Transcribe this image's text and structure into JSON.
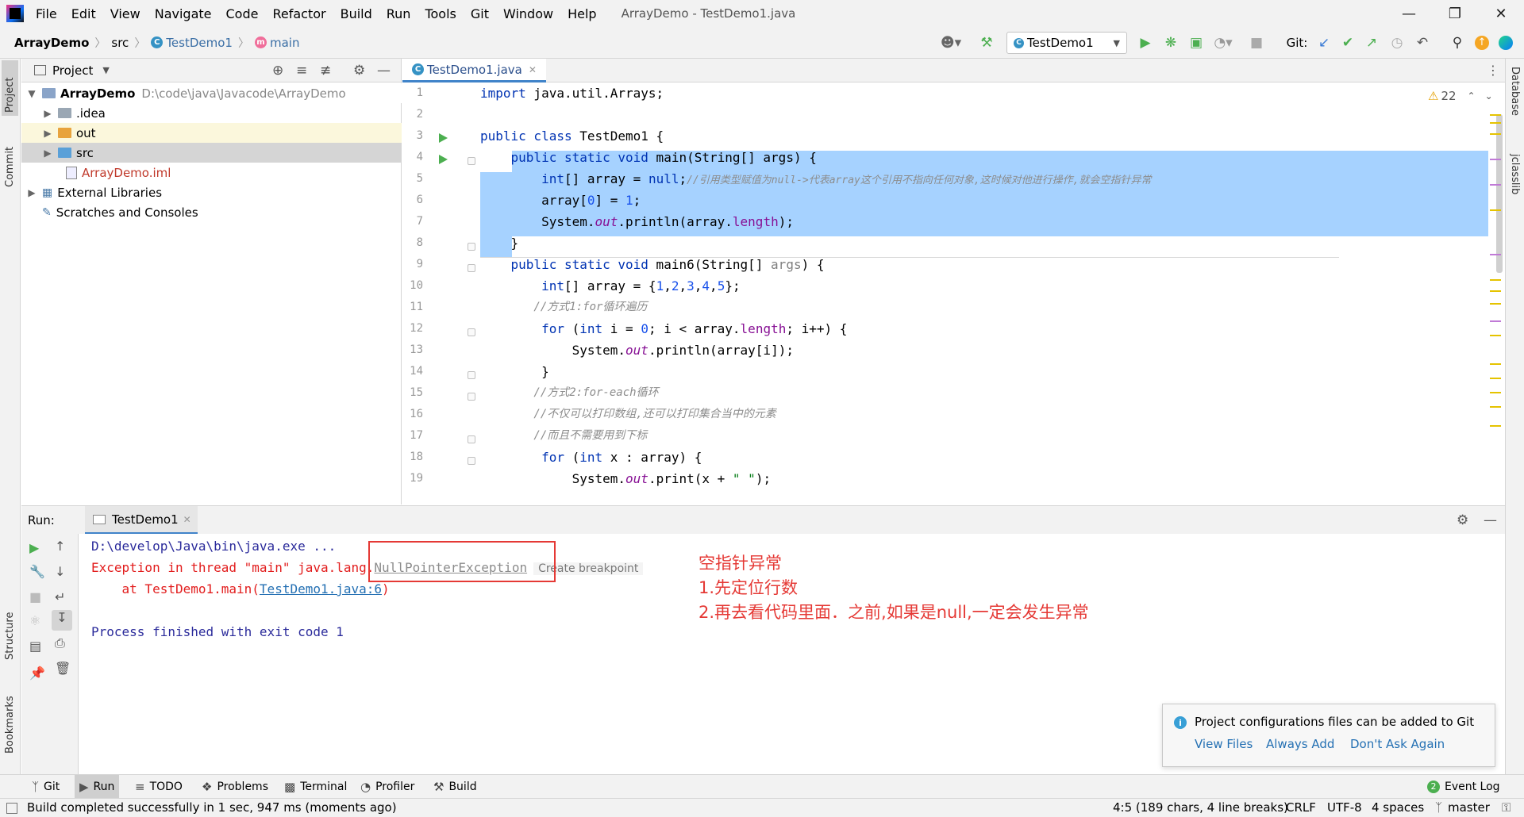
{
  "menu": {
    "items": [
      "File",
      "Edit",
      "View",
      "Navigate",
      "Code",
      "Refactor",
      "Build",
      "Run",
      "Tools",
      "Git",
      "Window",
      "Help"
    ],
    "window_title": "ArrayDemo - TestDemo1.java"
  },
  "breadcrumb": {
    "project": "ArrayDemo",
    "folder": "src",
    "class": "TestDemo1",
    "method": "main"
  },
  "toolbar": {
    "run_config": "TestDemo1",
    "git_label": "Git:"
  },
  "project_panel": {
    "title": "Project",
    "root_name": "ArrayDemo",
    "root_path": "D:\\code\\java\\Javacode\\ArrayDemo",
    "items": [
      ".idea",
      "out",
      "src",
      "ArrayDemo.iml"
    ],
    "external": "External Libraries",
    "scratches": "Scratches and Consoles"
  },
  "editor": {
    "tab": "TestDemo1.java",
    "warnings": "22",
    "line_numbers": [
      "1",
      "2",
      "3",
      "4",
      "5",
      "6",
      "7",
      "8",
      "9",
      "10",
      "11",
      "12",
      "13",
      "14",
      "15",
      "16",
      "17",
      "18",
      "19"
    ],
    "lines": {
      "l1a": "import",
      "l1b": " java.util.Arrays;",
      "l3a": "public class",
      "l3b": " TestDemo1 {",
      "l4a": "    public static void",
      "l4b": " main(String[] args) {",
      "l5a": "        int",
      "l5b": "[] array = ",
      "l5c": "null",
      "l5d": ";",
      "l5e": "//引用类型赋值为null->代表array这个引用不指向任何对象,这时候对他进行操作,就会空指针异常",
      "l6a": "        array[",
      "l6b": "0",
      "l6c": "] = ",
      "l6d": "1",
      "l6e": ";",
      "l7a": "        System.",
      "l7b": "out",
      "l7c": ".println(array.",
      "l7d": "length",
      "l7e": ");",
      "l8": "    }",
      "l9a": "    public static void",
      "l9b": " main6(String[] ",
      "l9c": "args",
      "l9d": ") {",
      "l10a": "        int",
      "l10b": "[] array = {",
      "l10c": "1",
      "l10d": ",",
      "l10e": "2",
      "l10f": ",",
      "l10g": "3",
      "l10h": ",",
      "l10i": "4",
      "l10j": ",",
      "l10k": "5",
      "l10l": "};",
      "l11": "        //方式1:for循环遍历",
      "l12a": "        for",
      "l12b": " (",
      "l12c": "int",
      "l12d": " i = ",
      "l12e": "0",
      "l12f": "; i < array.",
      "l12g": "length",
      "l12h": "; i++) {",
      "l13a": "            System.",
      "l13b": "out",
      "l13c": ".println(array[i]);",
      "l14": "        }",
      "l15": "        //方式2:for-each循环",
      "l16": "        //不仅可以打印数组,还可以打印集合当中的元素",
      "l17": "        //而且不需要用到下标",
      "l18a": "        for",
      "l18b": " (",
      "l18c": "int",
      "l18d": " x : array) {",
      "l19a": "            System.",
      "l19b": "out",
      "l19c": ".print(x + ",
      "l19d": "\" \"",
      "l19e": ");"
    }
  },
  "run_panel": {
    "label": "Run:",
    "tab": "TestDemo1",
    "console": {
      "cmd": "D:\\develop\\Java\\bin\\java.exe ...",
      "exc_prefix": "Exception in thread \"main\" java.lang.",
      "exc_class": "NullPointerException",
      "create_bp": "Create breakpoint",
      "at_prefix": "    at TestDemo1.main(",
      "at_link": "TestDemo1.java:6",
      "at_suffix": ")",
      "finished": "Process finished with exit code 1"
    },
    "annotation": {
      "line1": "空指针异常",
      "line2": "1.先定位行数",
      "line3": "2.再去看代码里面．之前,如果是null,一定会发生异常"
    }
  },
  "notification": {
    "message": "Project configurations files can be added to Git",
    "actions": [
      "View Files",
      "Always Add",
      "Don't Ask Again"
    ]
  },
  "tool_windows": [
    "Git",
    "Run",
    "TODO",
    "Problems",
    "Terminal",
    "Profiler",
    "Build",
    "Event Log"
  ],
  "side_tabs": {
    "project": "Project",
    "commit": "Commit",
    "structure": "Structure",
    "bookmarks": "Bookmarks",
    "database": "Database",
    "jclasslib": "jclasslib"
  },
  "status_bar": {
    "message": "Build completed successfully in 1 sec, 947 ms (moments ago)",
    "position": "4:5 (189 chars, 4 line breaks)",
    "line_sep": "CRLF",
    "encoding": "UTF-8",
    "indent": "4 spaces",
    "branch": "master"
  },
  "colors": {
    "keyword": "#0033b3",
    "number": "#1750eb",
    "comment": "#8c8c8c",
    "field": "#871094",
    "error": "#e21d1d",
    "selection": "#a6d2ff",
    "annotation": "#e53935"
  }
}
